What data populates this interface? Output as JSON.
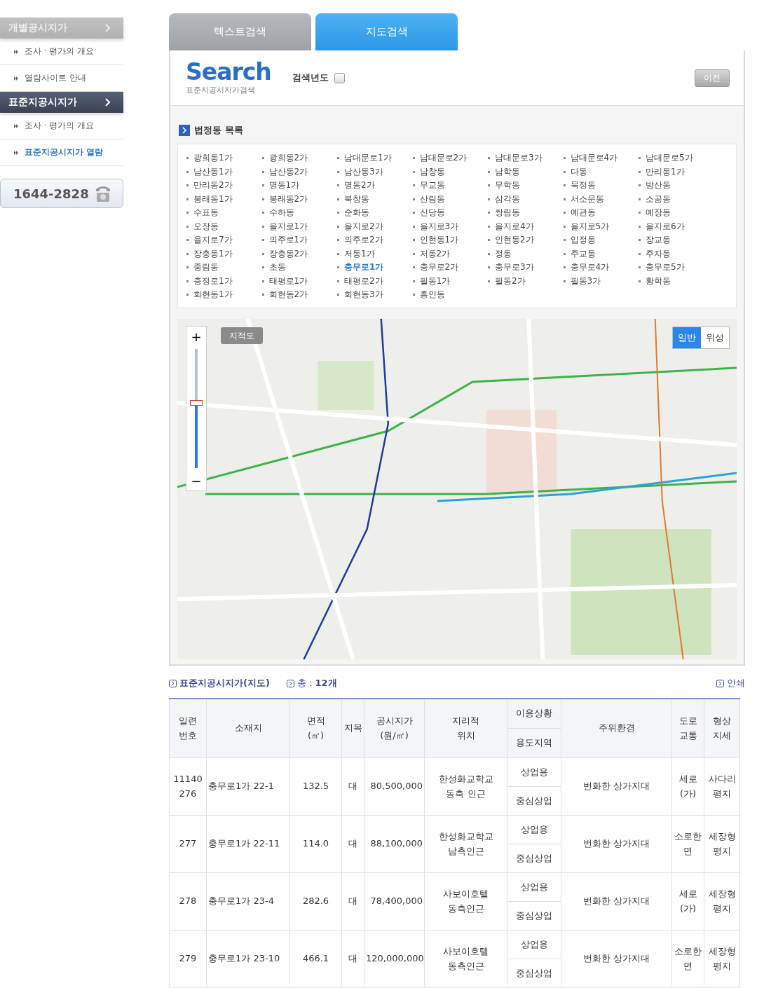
{
  "sidebar": {
    "sections": [
      {
        "title": "개별공시지가",
        "selected": false,
        "items": [
          {
            "label": "조사 · 평가의 개요",
            "selected": false
          },
          {
            "label": "열람사이트 안내",
            "selected": false
          }
        ]
      },
      {
        "title": "표준지공시지가",
        "selected": true,
        "items": [
          {
            "label": "조사 · 평가의 개요",
            "selected": false
          },
          {
            "label": "표준지공시지가 열람",
            "selected": true
          }
        ]
      }
    ],
    "phone": "1644-2828"
  },
  "tabs": [
    {
      "label": "텍스트검색",
      "selected": false
    },
    {
      "label": "지도검색",
      "selected": true
    }
  ],
  "search_header": {
    "logo": "Search",
    "subtitle": "표준지공시지가검색",
    "year_label": "검색년도",
    "year_checked": false,
    "prev_button": "이전"
  },
  "dong_list": {
    "title": "법정동 목록",
    "items": [
      {
        "label": "광희동1가",
        "selected": false
      },
      {
        "label": "광희동2가",
        "selected": false
      },
      {
        "label": "남대문로1가",
        "selected": false
      },
      {
        "label": "남대문로2가",
        "selected": false
      },
      {
        "label": "남대문로3가",
        "selected": false
      },
      {
        "label": "남대문로4가",
        "selected": false
      },
      {
        "label": "남대문로5가",
        "selected": false
      },
      {
        "label": "남산동1가",
        "selected": false
      },
      {
        "label": "남산동2가",
        "selected": false
      },
      {
        "label": "남산동3가",
        "selected": false
      },
      {
        "label": "남창동",
        "selected": false
      },
      {
        "label": "남학동",
        "selected": false
      },
      {
        "label": "다동",
        "selected": false
      },
      {
        "label": "만리동1가",
        "selected": false
      },
      {
        "label": "만리동2가",
        "selected": false
      },
      {
        "label": "명동1가",
        "selected": false
      },
      {
        "label": "명동2가",
        "selected": false
      },
      {
        "label": "무교동",
        "selected": false
      },
      {
        "label": "무학동",
        "selected": false
      },
      {
        "label": "묵정동",
        "selected": false
      },
      {
        "label": "방산동",
        "selected": false
      },
      {
        "label": "봉래동1가",
        "selected": false
      },
      {
        "label": "봉래동2가",
        "selected": false
      },
      {
        "label": "북창동",
        "selected": false
      },
      {
        "label": "산림동",
        "selected": false
      },
      {
        "label": "삼각동",
        "selected": false
      },
      {
        "label": "서소문동",
        "selected": false
      },
      {
        "label": "소공동",
        "selected": false
      },
      {
        "label": "수표동",
        "selected": false
      },
      {
        "label": "수하동",
        "selected": false
      },
      {
        "label": "순화동",
        "selected": false
      },
      {
        "label": "신당동",
        "selected": false
      },
      {
        "label": "쌍림동",
        "selected": false
      },
      {
        "label": "예관동",
        "selected": false
      },
      {
        "label": "예장동",
        "selected": false
      },
      {
        "label": "오장동",
        "selected": false
      },
      {
        "label": "을지로1가",
        "selected": false
      },
      {
        "label": "을지로2가",
        "selected": false
      },
      {
        "label": "을지로3가",
        "selected": false
      },
      {
        "label": "을지로4가",
        "selected": false
      },
      {
        "label": "을지로5가",
        "selected": false
      },
      {
        "label": "을지로6가",
        "selected": false
      },
      {
        "label": "을지로7가",
        "selected": false
      },
      {
        "label": "의주로1가",
        "selected": false
      },
      {
        "label": "의주로2가",
        "selected": false
      },
      {
        "label": "인현동1가",
        "selected": false
      },
      {
        "label": "인현동2가",
        "selected": false
      },
      {
        "label": "입정동",
        "selected": false
      },
      {
        "label": "장교동",
        "selected": false
      },
      {
        "label": "장충동1가",
        "selected": false
      },
      {
        "label": "장충동2가",
        "selected": false
      },
      {
        "label": "저동1가",
        "selected": false
      },
      {
        "label": "저동2가",
        "selected": false
      },
      {
        "label": "정동",
        "selected": false
      },
      {
        "label": "주교동",
        "selected": false
      },
      {
        "label": "주자동",
        "selected": false
      },
      {
        "label": "중림동",
        "selected": false
      },
      {
        "label": "초동",
        "selected": false
      },
      {
        "label": "충무로1가",
        "selected": true
      },
      {
        "label": "충무로2가",
        "selected": false
      },
      {
        "label": "충무로3가",
        "selected": false
      },
      {
        "label": "충무로4가",
        "selected": false
      },
      {
        "label": "충무로5가",
        "selected": false
      },
      {
        "label": "충정로1가",
        "selected": false
      },
      {
        "label": "태평로1가",
        "selected": false
      },
      {
        "label": "태평로2가",
        "selected": false
      },
      {
        "label": "필동1가",
        "selected": false
      },
      {
        "label": "필동2가",
        "selected": false
      },
      {
        "label": "필동3가",
        "selected": false
      },
      {
        "label": "황학동",
        "selected": false
      },
      {
        "label": "회현동1가",
        "selected": false
      },
      {
        "label": "회현동2가",
        "selected": false
      },
      {
        "label": "회현동3가",
        "selected": false
      },
      {
        "label": "흥인동",
        "selected": false
      }
    ]
  },
  "map": {
    "cadastral_button": "지적도",
    "zoom": {
      "plus": "+",
      "minus": "−",
      "level": 0.55
    },
    "map_types": [
      {
        "label": "일반",
        "selected": true
      },
      {
        "label": "위성",
        "selected": false
      }
    ]
  },
  "result_bar": {
    "title": "표준지공시지가(지도)",
    "count": "총 : **12개**",
    "print": "인쇄"
  },
  "table": {
    "columns": [
      "일련\n번호",
      "소재지",
      "면적\n(㎡)",
      "지목",
      "공시지가\n(원/㎡)",
      "지리적\n위치",
      "이용상황",
      "용도지역",
      "주위환경",
      "도로\n교통",
      "형상\n지세"
    ],
    "rows": [
      {
        "serial": "11140\n276",
        "address": "충무로1가 22-1",
        "area": "132.5",
        "category": "대",
        "price": "80,500,000",
        "location": "한성화교학교\n동측 인근",
        "use": "상업용",
        "zone": "중심상업",
        "surroundings": "번화한 상가지대",
        "road": "세로\n(가)",
        "shape": "사다리\n평지"
      },
      {
        "serial": "277",
        "address": "충무로1가 22-11",
        "area": "114.0",
        "category": "대",
        "price": "88,100,000",
        "location": "한성화교학교\n남측인근",
        "use": "상업용",
        "zone": "중심상업",
        "surroundings": "번화한 상가지대",
        "road": "소로한\n면",
        "shape": "세장형\n평지"
      },
      {
        "serial": "278",
        "address": "충무로1가 23-4",
        "area": "282.6",
        "category": "대",
        "price": "78,400,000",
        "location": "사보이호텔\n동측인근",
        "use": "상업용",
        "zone": "중심상업",
        "surroundings": "번화한 상가지대",
        "road": "세로\n(가)",
        "shape": "세장형\n평지"
      },
      {
        "serial": "279",
        "address": "충무로1가 23-10",
        "area": "466.1",
        "category": "대",
        "price": "120,000,000",
        "location": "사보이호텔\n동측인근",
        "use": "상업용",
        "zone": "중심상업",
        "surroundings": "번화한 상가지대",
        "road": "소로한\n면",
        "shape": "세장형\n평지"
      }
    ]
  }
}
